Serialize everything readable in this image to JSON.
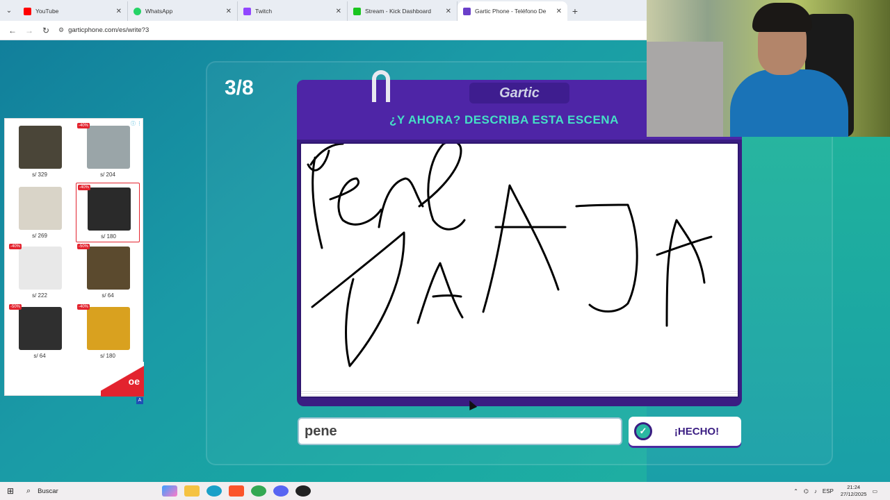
{
  "browser": {
    "tabs": [
      {
        "title": "YouTube",
        "favicon_color": "#ff0000"
      },
      {
        "title": "WhatsApp",
        "favicon_color": "#25d366"
      },
      {
        "title": "Twitch",
        "favicon_color": "#9146ff"
      },
      {
        "title": "Stream - Kick Dashboard",
        "favicon_color": "#1ac51f"
      },
      {
        "title": "Gartic Phone - Teléfono De",
        "favicon_color": "#6a3fc9"
      }
    ],
    "url": "garticphone.com/es/write?3"
  },
  "game": {
    "round": "3/8",
    "logo": "Gartic",
    "prompt": "¿Y AHORA? DESCRIBA ESTA ESCENA",
    "answer_value": "pene",
    "done_label": "¡HECHO!"
  },
  "ad": {
    "items": [
      {
        "price": "s/ 329",
        "badge": "",
        "color": "#4a4538"
      },
      {
        "price": "s/ 204",
        "badge": "-40%",
        "color": "#9aa5a8"
      },
      {
        "price": "s/ 269",
        "badge": "",
        "color": "#d9d4c8"
      },
      {
        "price": "s/ 180",
        "badge": "-40%",
        "color": "#2a2a2a"
      },
      {
        "price": "s/ 222",
        "badge": "-40%",
        "color": "#e8e8e8"
      },
      {
        "price": "s/ 64",
        "badge": "-50%",
        "color": "#5b4a2e"
      },
      {
        "price": "s/ 64",
        "badge": "-50%",
        "color": "#2f2f2f"
      },
      {
        "price": "s/ 180",
        "badge": "-40%",
        "color": "#d9a11f"
      }
    ],
    "brand": "oe",
    "mark": "A"
  },
  "taskbar": {
    "search_label": "Buscar",
    "lang": "ESP",
    "time": "21:24",
    "date": "27/12/2025"
  }
}
